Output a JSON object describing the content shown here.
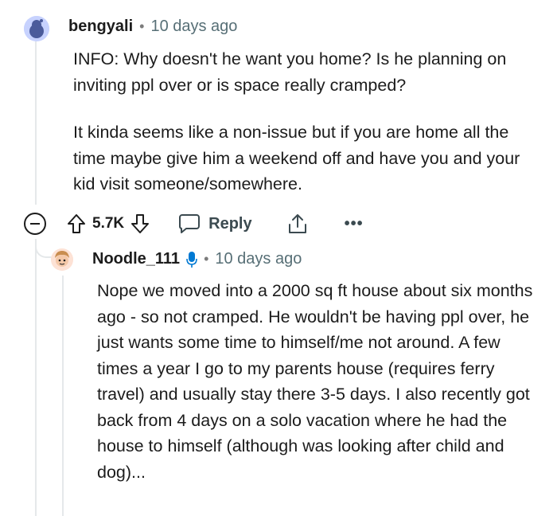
{
  "comment": {
    "username": "bengyali",
    "time": "10 days ago",
    "paragraphs": [
      "INFO: Why doesn't he want you home? Is he planning on inviting ppl over or is space really cramped?",
      "It kinda seems like a non-issue but if you are home all the time maybe give him a weekend off and have you and your kid visit someone/somewhere."
    ],
    "votes": "5.7K",
    "reply_label": "Reply",
    "more_label": "•••"
  },
  "reply": {
    "username": "Noodle_111",
    "time": "10 days ago",
    "text": "Nope we moved into a 2000 sq ft house about six months ago - so not cramped. He wouldn't be having ppl over, he just wants some time to himself/me not around. A few times a year I go to my parents house (requires ferry travel) and usually stay there 3-5 days. I also recently got back from 4 days on a solo vacation where he had the house to himself (although was looking after child and dog)..."
  },
  "separator": "•",
  "colors": {
    "text": "#1c1c1c",
    "meta": "#576f76",
    "thread": "#e5e8ea",
    "badge": "#0079d3"
  }
}
